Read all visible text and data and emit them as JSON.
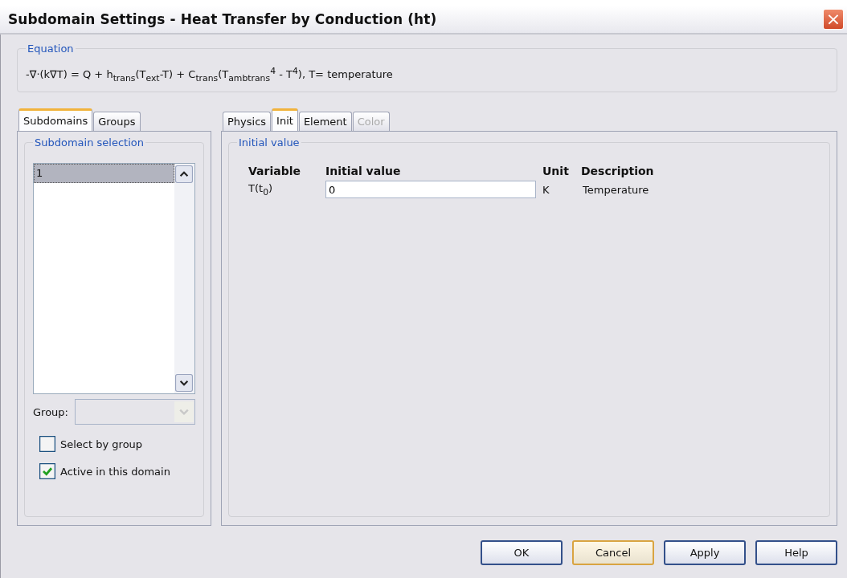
{
  "window": {
    "title": "Subdomain Settings - Heat Transfer by Conduction (ht)",
    "close": "×"
  },
  "equation": {
    "legend": "Equation",
    "text": "-∇·(k∇T) = Q + h$_{trans}$(T$_{ext}$-T) + C$_{trans}$(T$_{ambtrans}$$^{4}$ - T$^{4}$), T= temperature"
  },
  "left_tabs": [
    {
      "label": "Subdomains",
      "selected": true
    },
    {
      "label": "Groups",
      "selected": false
    }
  ],
  "subdomain_selection": {
    "legend": "Subdomain selection",
    "items": [
      {
        "label": "1",
        "selected": true
      }
    ],
    "group": {
      "label": "Group:",
      "disabled": true
    },
    "checkboxes": [
      {
        "label": "Select by group",
        "checked": false
      },
      {
        "label": "Active in this domain",
        "checked": true
      }
    ]
  },
  "right_tabs": [
    {
      "label": "Physics",
      "selected": false,
      "disabled": false
    },
    {
      "label": "Init",
      "selected": true,
      "disabled": false
    },
    {
      "label": "Element",
      "selected": false,
      "disabled": false
    },
    {
      "label": "Color",
      "selected": false,
      "disabled": true
    }
  ],
  "initial_value": {
    "legend": "Initial value",
    "columns": [
      "Variable",
      "Initial value",
      "Unit",
      "Description"
    ],
    "rows": [
      {
        "variable": "T(t$_{0}$)",
        "value": "0",
        "unit": "K",
        "description": "Temperature"
      }
    ]
  },
  "buttons": [
    {
      "label": "OK",
      "focused": false
    },
    {
      "label": "Cancel",
      "focused": true
    },
    {
      "label": "Apply",
      "focused": false
    },
    {
      "label": "Help",
      "focused": false
    }
  ]
}
